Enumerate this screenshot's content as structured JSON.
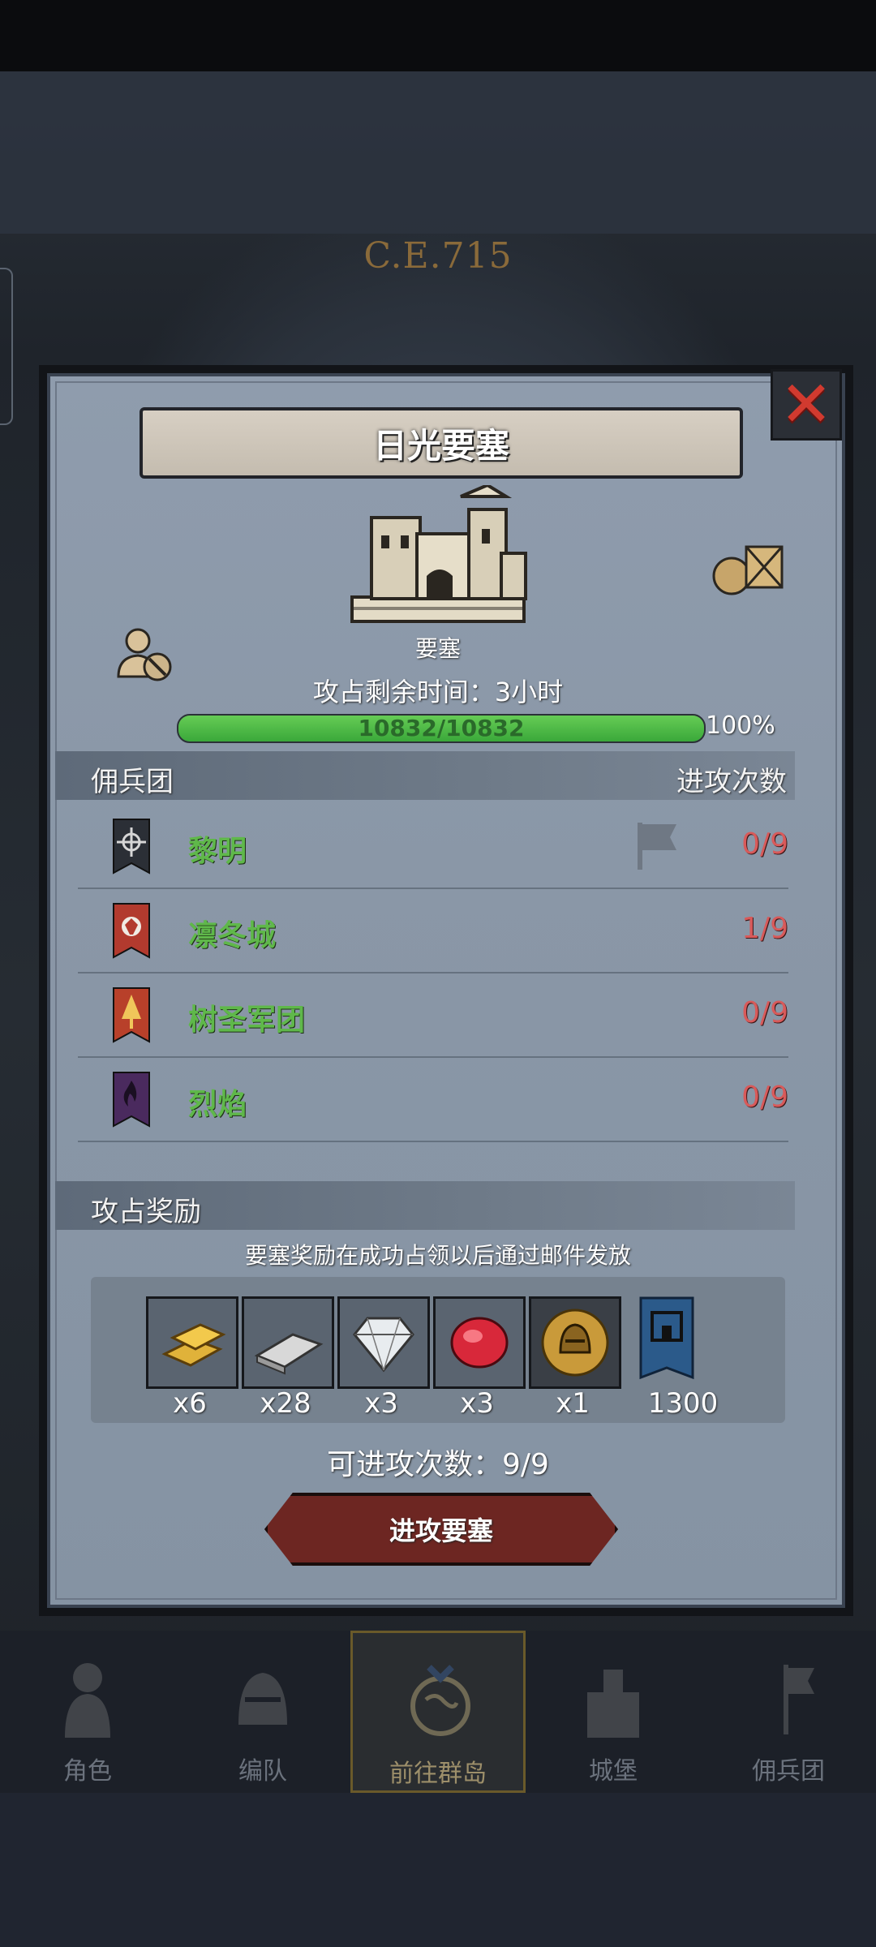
{
  "background": {
    "era": "C.E.715"
  },
  "panel": {
    "title": "日光要塞",
    "fortress_label": "要塞",
    "timer_text": "攻占剩余时间：3小时",
    "progress": {
      "text": "10832/10832",
      "percent_label": "100%",
      "fraction": 1.0
    },
    "mercenary_header": "佣兵团",
    "attack_count_header": "进攻次数",
    "mercenaries": [
      {
        "name": "黎明",
        "count": "0/9",
        "color": "#2b2f36"
      },
      {
        "name": "凛冬城",
        "count": "1/9",
        "color": "#b23a2e"
      },
      {
        "name": "树圣军团",
        "count": "0/9",
        "color": "#b8402a"
      },
      {
        "name": "烈焰",
        "count": "0/9",
        "color": "#4a2a5e"
      }
    ],
    "reward_header": "攻占奖励",
    "reward_note": "要塞奖励在成功占领以后通过邮件发放",
    "rewards": [
      {
        "icon": "gold-bar-icon",
        "qty": "x6"
      },
      {
        "icon": "iron-bar-icon",
        "qty": "x28"
      },
      {
        "icon": "diamond-icon",
        "qty": "x3"
      },
      {
        "icon": "ruby-icon",
        "qty": "x3"
      },
      {
        "icon": "helmet-medal-icon",
        "qty": "x1"
      },
      {
        "icon": "fortress-banner-icon",
        "qty": "1300"
      }
    ],
    "attack_remaining": "可进攻次数：9/9",
    "attack_button": "进攻要塞"
  },
  "nav": [
    {
      "label": "角色"
    },
    {
      "label": "编队"
    },
    {
      "label": "前往群岛"
    },
    {
      "label": "城堡"
    },
    {
      "label": "佣兵团"
    }
  ],
  "colors": {
    "accent_green": "#5fb84a",
    "count_red": "#d85a5a",
    "close_red": "#d13a2f"
  }
}
